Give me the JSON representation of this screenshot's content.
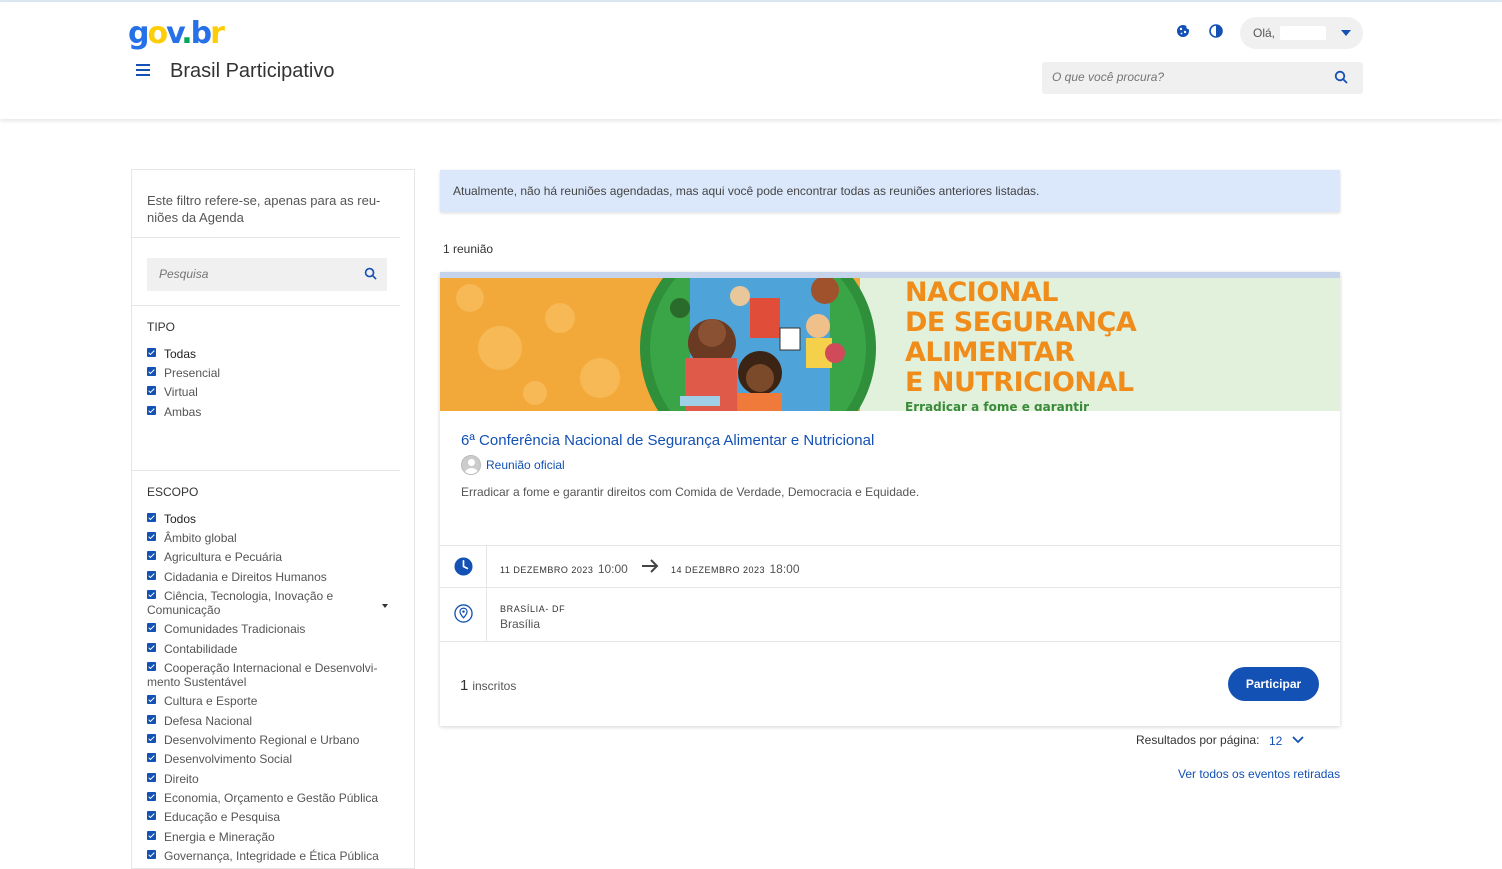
{
  "header": {
    "logo": {
      "g": "g",
      "o": "o",
      "v": "v",
      "dot": ".",
      "b": "b",
      "r": "r"
    },
    "site_title": "Brasil Participativo",
    "user_greeting": "Olá,",
    "search_placeholder": "O que você procura?",
    "icons": [
      "cookie-icon",
      "contrast-icon",
      "search-icon",
      "menu-icon"
    ]
  },
  "sidebar": {
    "note": "Este filtro refere-se, apenas para as reu-niões da Agenda",
    "search_placeholder": "Pesquisa",
    "tipo": {
      "heading": "TIPO",
      "items": [
        "Todas",
        "Presencial",
        "Virtual",
        "Ambas"
      ]
    },
    "escopo": {
      "heading": "ESCOPO",
      "items": [
        "Todos",
        "Âmbito global",
        "Agricultura e Pecuária",
        "Cidadania e Direitos Humanos",
        "Ciência, Tecnologia, Inovação e Comunicação",
        "Comunidades Tradicionais",
        "Contabilidade",
        "Cooperação Internacional e Desenvolvi-mento Sustentável",
        "Cultura e Esporte",
        "Defesa Nacional",
        "Desenvolvimento Regional e Urbano",
        "Desenvolvimento Social",
        "Direito",
        "Economia, Orçamento e Gestão Pública",
        "Educação e Pesquisa",
        "Energia e Mineração",
        "Governança, Integridade e Ética Pública"
      ]
    }
  },
  "main": {
    "alert": "Atualmente, não há reuniões agendadas, mas aqui você pode encontrar todas as reuniões anteriores listadas.",
    "count": "1 reunião",
    "card": {
      "banner_lines": [
        "NACIONAL",
        "DE SEGURANÇA",
        "ALIMENTAR",
        "E NUTRICIONAL"
      ],
      "banner_sub": "Erradicar a fome e garantir",
      "title": "6ª Conferência Nacional de Segurança Alimentar e Nutricional",
      "badge": "Reunião oficial",
      "description": "Erradicar a fome e garantir direitos com Comida de Verdade, Democracia e Equidade.",
      "start_date": "11 DEZEMBRO 2023",
      "start_time": "10:00",
      "end_date": "14 DEZEMBRO 2023",
      "end_time": "18:00",
      "location_line1": "BRASÍLIA- DF",
      "location_line2": "Brasília",
      "inscritos_count": "1",
      "inscritos_label": "inscritos",
      "button": "Participar"
    },
    "per_page_label": "Resultados por página:",
    "per_page_value": "12",
    "see_all": "Ver todos os eventos retiradas"
  },
  "colors": {
    "primary": "#1351b4",
    "alert_bg": "#dbe8fb",
    "banner_orange": "#ef8c1a",
    "banner_green": "#2f8f3a"
  }
}
